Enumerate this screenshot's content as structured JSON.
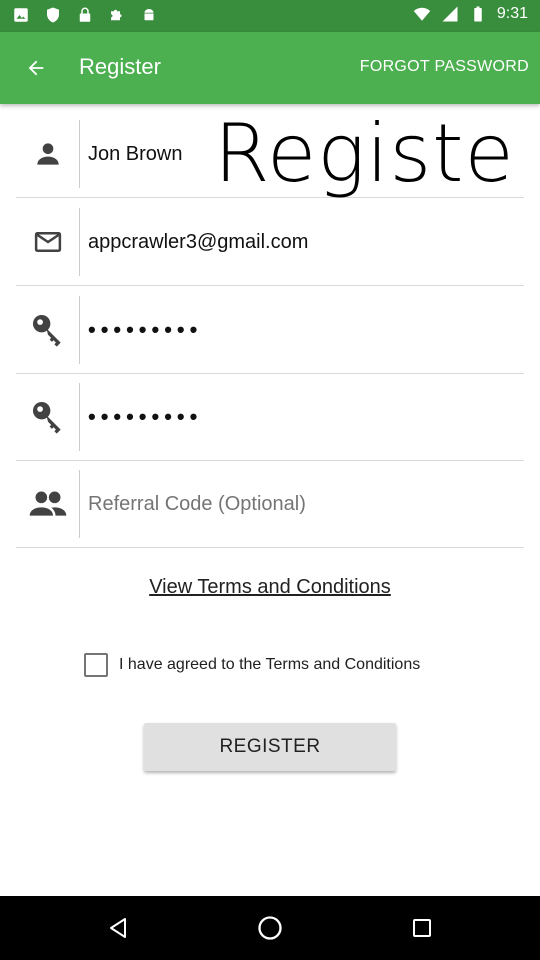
{
  "status_bar": {
    "time": "9:31",
    "icons": [
      "image-icon",
      "shield-icon",
      "lock-icon",
      "puzzle-icon",
      "android-icon",
      "wifi-icon",
      "signal-icon",
      "battery-icon"
    ]
  },
  "app_bar": {
    "title": "Register",
    "forgot_password_label": "FORGOT PASSWORD",
    "background": "#4caf50",
    "status_background": "#388e3c"
  },
  "form": {
    "name": {
      "value": "Jon Brown",
      "icon": "person-icon"
    },
    "email": {
      "value": "appcrawler3@gmail.com",
      "icon": "mail-icon"
    },
    "password": {
      "value": "•••••••••",
      "icon": "key-icon"
    },
    "confirm_password": {
      "value": "•••••••••",
      "icon": "key-icon"
    },
    "referral": {
      "placeholder": "Referral Code (Optional)",
      "icon": "group-icon"
    }
  },
  "overlay_text": "Registe",
  "terms": {
    "link_label": "View Terms and Conditions",
    "agree_label": "I have agreed to the Terms and Conditions",
    "agreed": false
  },
  "register_button_label": "REGISTER",
  "nav_bar": {
    "icons": [
      "back-icon",
      "home-icon",
      "recents-icon"
    ]
  }
}
